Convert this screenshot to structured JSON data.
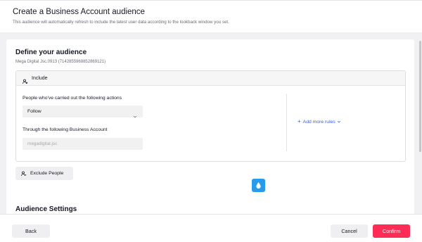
{
  "header": {
    "title": "Create a Business Account audience",
    "subtitle": "This audience will automatically refresh to include the latest user data according to the lookback window you set."
  },
  "define": {
    "title": "Define your audience",
    "account_subtitle": "Mega Digital Jsc.0913 (7142855968852869121)"
  },
  "include": {
    "label": "Include",
    "icon": "person-add-icon",
    "actions_label": "People who've carried out the following actions",
    "action_value": "Follow",
    "account_label": "Through the following Business Account",
    "account_value": "megadigital.jsc",
    "add_more_rules": "Add more rules"
  },
  "exclude": {
    "label": "Exclude People",
    "icon": "person-remove-icon"
  },
  "settings": {
    "title": "Audience Settings"
  },
  "footer": {
    "back_label": "Back",
    "cancel_label": "Cancel",
    "confirm_label": "Confirm"
  },
  "colors": {
    "accent": "#fe2c55",
    "link": "#3b5bdb",
    "drop_badge": "#2a9be8"
  }
}
